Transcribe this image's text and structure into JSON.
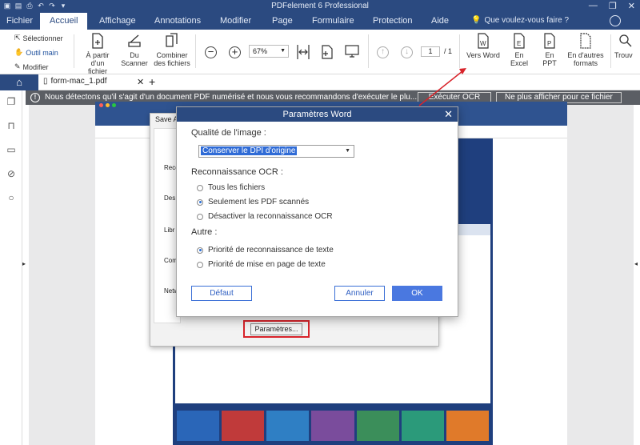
{
  "app": {
    "title": "PDFelement 6 Professional"
  },
  "menus": [
    "Fichier",
    "Accueil",
    "Affichage",
    "Annotations",
    "Modifier",
    "Page",
    "Formulaire",
    "Protection",
    "Aide"
  ],
  "search": {
    "placeholder": "Que voulez-vous faire ?"
  },
  "ribbon": {
    "select_label": "Sélectionner",
    "hand_label": "Outil main",
    "edit_label": "Modifier",
    "from_file_label": "À partir d'un fichier",
    "from_file_l1": "À partir",
    "from_file_l2": "d'un fichier",
    "scanner_l1": "Du",
    "scanner_l2": "Scanner",
    "combine_l1": "Combiner",
    "combine_l2": "des fichiers",
    "zoom": "67%",
    "page_current": "1",
    "page_total": "/ 1",
    "to_word": "Vers Word",
    "to_excel": "En Excel",
    "to_ppt": "En PPT",
    "other_l1": "En d'autres",
    "other_l2": "formats",
    "find": "Trouv"
  },
  "tabs": {
    "doc_name": "form-mac_1.pdf"
  },
  "notification": {
    "message": "Nous détectons qu'il s'agit d'un document PDF numérisé et nous vous recommandons d'exécuter le plu...",
    "ocr_button": "Exécuter OCR",
    "dismiss_button": "Ne plus afficher pour ce fichier"
  },
  "save_as": {
    "title": "Save As",
    "sidebar_labels": [
      "Recen",
      "Des",
      "Libr",
      "Comp",
      "Netw"
    ],
    "params_button": "Paramètres..."
  },
  "word_dialog": {
    "title": "Paramètres Word",
    "image_quality_label": "Qualité de l'image :",
    "image_quality_value": "Conserver le DPI d'origine",
    "ocr_label": "Reconnaissance OCR :",
    "ocr_options": [
      "Tous les fichiers",
      "Seulement les PDF scannés",
      "Désactiver la reconnaissance OCR"
    ],
    "ocr_selected": 1,
    "other_label": "Autre :",
    "other_options": [
      "Priorité de reconnaissance de texte",
      "Priorité de mise en page de texte"
    ],
    "other_selected": 0,
    "default_button": "Défaut",
    "cancel_button": "Annuler",
    "ok_button": "OK"
  },
  "colors": {
    "title_bar": "#2b4a80",
    "notification": "#5b5e64",
    "accent_blue": "#4a78e0",
    "highlight_red": "#d8232a"
  }
}
